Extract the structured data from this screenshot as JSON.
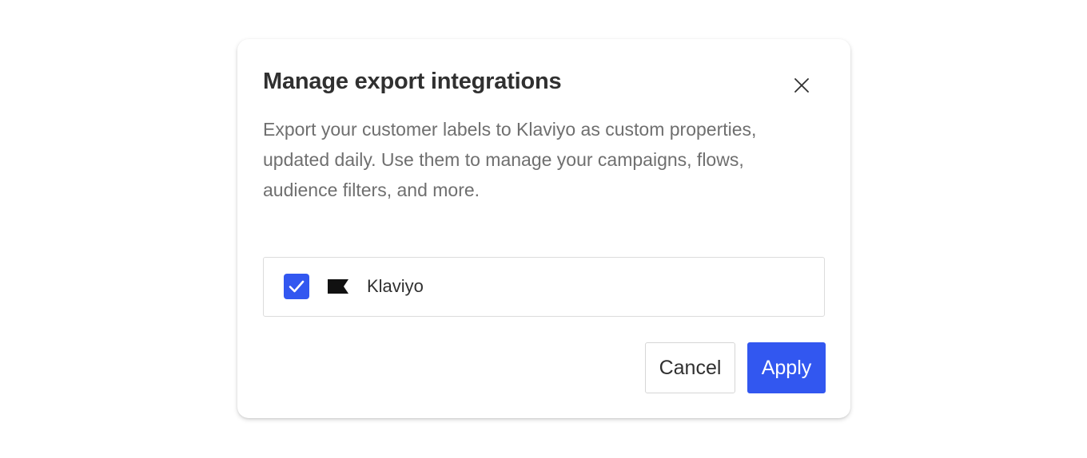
{
  "dialog": {
    "title": "Manage export integrations",
    "description": "Export your customer labels to Klaviyo as custom properties, updated daily. Use them to manage your campaigns, flows, audience filters, and more.",
    "close_icon": "close-icon"
  },
  "integrations": [
    {
      "name": "Klaviyo",
      "checked": true,
      "icon": "klaviyo-flag-logo"
    }
  ],
  "actions": {
    "cancel_label": "Cancel",
    "apply_label": "Apply"
  },
  "colors": {
    "accent": "#3257f0",
    "title_text": "#303030",
    "body_text": "#6f6f6f",
    "border": "#dcdcdc"
  }
}
